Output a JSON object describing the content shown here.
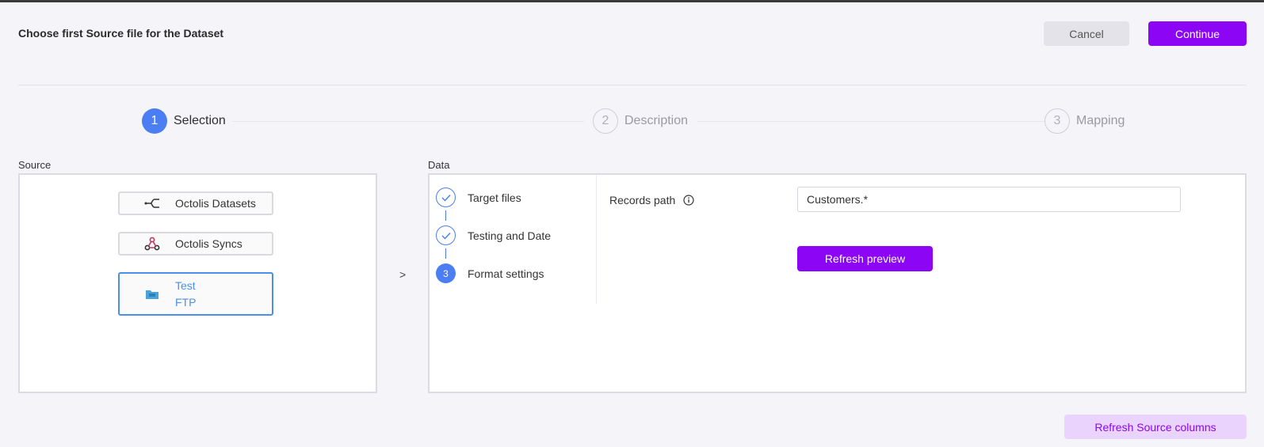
{
  "header": {
    "title": "Choose first Source file for the Dataset",
    "cancel_label": "Cancel",
    "continue_label": "Continue"
  },
  "stepper": {
    "steps": [
      {
        "number": "1",
        "label": "Selection",
        "state": "active"
      },
      {
        "number": "2",
        "label": "Description",
        "state": "inactive"
      },
      {
        "number": "3",
        "label": "Mapping",
        "state": "inactive"
      }
    ]
  },
  "source": {
    "label": "Source",
    "items": [
      {
        "label": "Octolis Datasets",
        "icon": "dataset-merge-icon"
      },
      {
        "label": "Octolis Syncs",
        "icon": "webhook-icon"
      },
      {
        "label_line1": "Test",
        "label_line2": "FTP",
        "icon": "ftp-folder-icon",
        "selected": true
      }
    ]
  },
  "arrow": ">",
  "data": {
    "label": "Data",
    "substeps": [
      {
        "label": "Target files",
        "state": "done"
      },
      {
        "label": "Testing and Date",
        "state": "done"
      },
      {
        "number": "3",
        "label": "Format settings",
        "state": "current"
      }
    ],
    "records_path_label": "Records path",
    "records_path_value": "Customers.*",
    "refresh_preview_label": "Refresh preview"
  },
  "footer": {
    "refresh_source_label": "Refresh Source columns"
  },
  "colors": {
    "accent": "#8c05f5",
    "step_active": "#4a7ef2",
    "selected_border": "#4a90e8"
  }
}
